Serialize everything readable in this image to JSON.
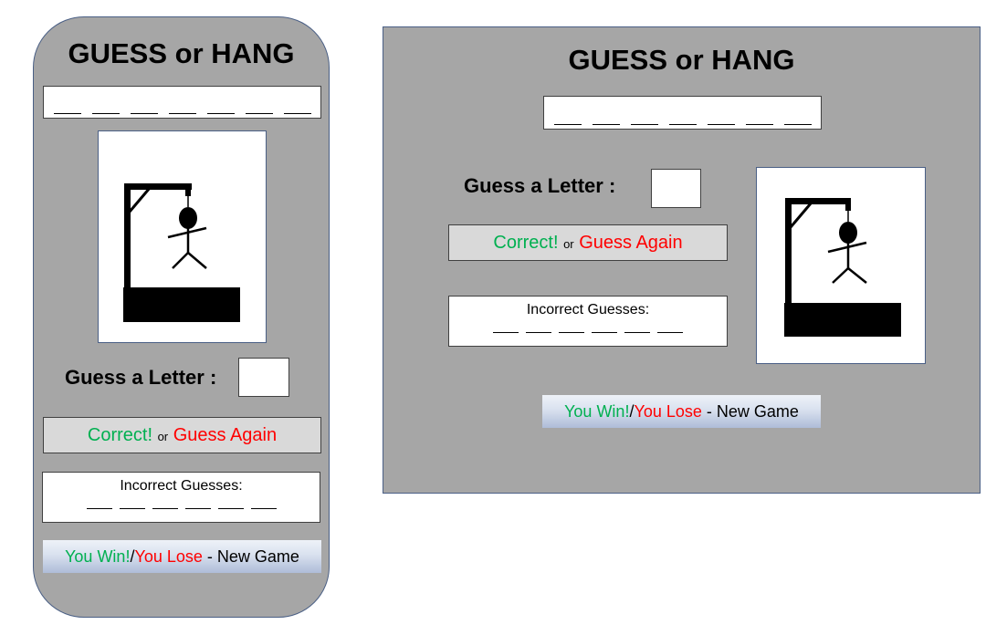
{
  "game": {
    "title": "GUESS or HANG",
    "guess_label": "Guess a Letter :",
    "feedback_correct": "Correct!",
    "feedback_or": "or",
    "feedback_retry": "Guess Again",
    "incorrect_label": "Incorrect Guesses:",
    "win_text": "You Win!",
    "separator": "/",
    "lose_text": "You Lose",
    "new_game_text": " - New Game",
    "word_blank_count": 7,
    "incorrect_blank_count": 6
  },
  "colors": {
    "panel": "#a6a6a6",
    "correct": "#00b050",
    "retry": "#ff0000",
    "border": "#4a5f85"
  }
}
